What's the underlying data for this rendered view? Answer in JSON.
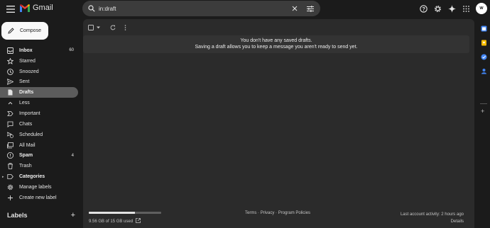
{
  "app": {
    "name": "Gmail"
  },
  "icons": {
    "menu": "menu-icon",
    "search": "search-icon",
    "clear": "close-icon",
    "tune": "tune-icon",
    "help": "help-icon",
    "settings": "gear-icon",
    "gemini": "sparkle-icon",
    "apps": "apps-grid-icon"
  },
  "colors": {
    "gmail_red": "#ea4335",
    "gmail_blue": "#4285f4",
    "gmail_yellow": "#fbbc04",
    "gmail_green": "#34a853",
    "active_nav": "#5c5c5c"
  },
  "search": {
    "value": "in:draft"
  },
  "account": {
    "avatar_initials": "W"
  },
  "compose": {
    "label": "Compose"
  },
  "nav": [
    {
      "label": "Inbox",
      "icon": "inbox-icon",
      "count": "60",
      "bold": true
    },
    {
      "label": "Starred",
      "icon": "star-icon"
    },
    {
      "label": "Snoozed",
      "icon": "clock-icon"
    },
    {
      "label": "Sent",
      "icon": "send-icon"
    },
    {
      "label": "Drafts",
      "icon": "draft-icon",
      "bold": true,
      "active": true
    },
    {
      "label": "Less",
      "icon": "chevron-up-icon"
    },
    {
      "label": "Important",
      "icon": "important-icon"
    },
    {
      "label": "Chats",
      "icon": "chat-icon"
    },
    {
      "label": "Scheduled",
      "icon": "schedule-send-icon"
    },
    {
      "label": "All Mail",
      "icon": "all-mail-icon"
    },
    {
      "label": "Spam",
      "icon": "spam-icon",
      "count": "4",
      "bold": true
    },
    {
      "label": "Trash",
      "icon": "trash-icon"
    },
    {
      "label": "Categories",
      "icon": "label-icon",
      "bold": true,
      "expandable": true
    },
    {
      "label": "Manage labels",
      "icon": "gear-icon"
    },
    {
      "label": "Create new label",
      "icon": "plus-icon"
    }
  ],
  "labels": {
    "title": "Labels"
  },
  "empty_state": {
    "line1": "You don't have any saved drafts.",
    "line2": "Saving a draft allows you to keep a message you aren't ready to send yet."
  },
  "storage": {
    "text": "9.56 GB of 15 GB used",
    "used_fraction": 0.637
  },
  "footer": {
    "terms": "Terms",
    "sep": " · ",
    "privacy": "Privacy",
    "policies": "Program Policies"
  },
  "activity": {
    "text": "Last account activity: 2 hours ago",
    "details": "Details"
  }
}
